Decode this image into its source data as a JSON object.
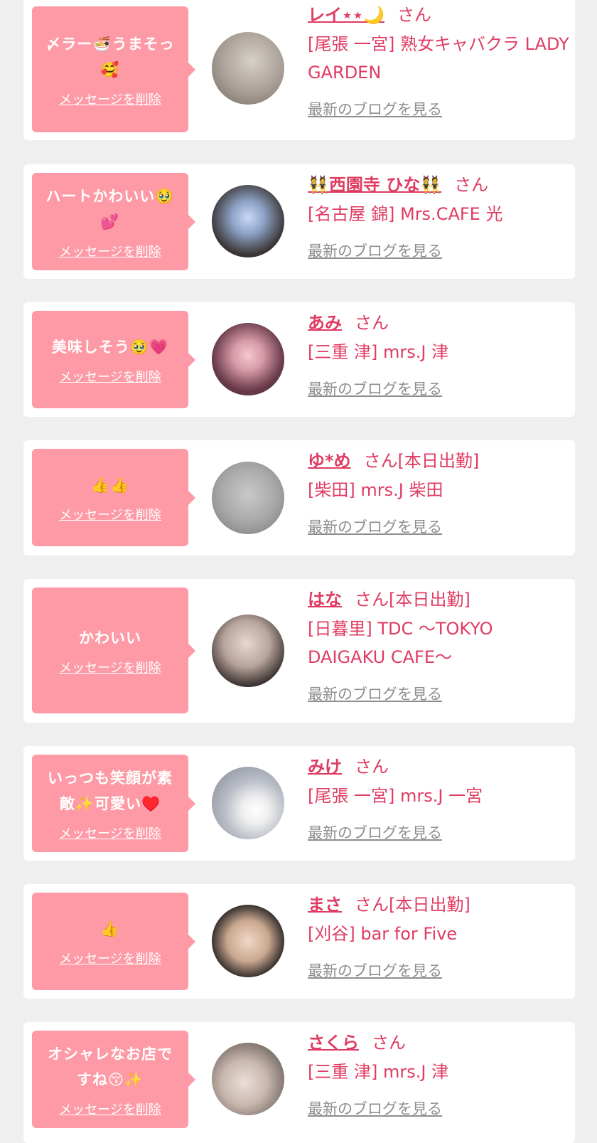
{
  "colors": {
    "page_bg": "#efefef",
    "card_bg": "#ffffff",
    "bubble_bg": "#fe9aa5",
    "accent_pink": "#e03b62",
    "link_gray": "#8e8e8e"
  },
  "delete_label": "メッセージを削除",
  "blog_label": "最新のブログを見る",
  "items": [
    {
      "message": "〆ラー🍜うまそっ🥰",
      "name": "レイ⋆⋆🌙",
      "suffix": "さん",
      "shop": "[尾張 一宮] 熟女キャバクラ LADY GARDEN"
    },
    {
      "message": "ハートかわいい🥹💕",
      "name": "👯西園寺 ひな👯",
      "suffix": "さん",
      "shop": "[名古屋 錦] Mrs.CAFE 光"
    },
    {
      "message": "美味しそう🥹💗",
      "name": "あみ",
      "suffix": "さん",
      "shop": "[三重 津] mrs.J 津"
    },
    {
      "message": "👍👍",
      "name": "ゆ*め",
      "suffix": "さん[本日出勤]",
      "shop": "[柴田] mrs.J 柴田"
    },
    {
      "message": "かわいい",
      "name": "はな",
      "suffix": "さん[本日出勤]",
      "shop": "[日暮里] TDC ～TOKYO DAIGAKU CAFE～"
    },
    {
      "message": "いっつも笑顔が素敵✨可愛い♥️",
      "name": "みけ",
      "suffix": "さん",
      "shop": "[尾張 一宮] mrs.J 一宮"
    },
    {
      "message": "👍",
      "name": "まさ",
      "suffix": "さん[本日出勤]",
      "shop": "[刈谷] bar for Five"
    },
    {
      "message": "オシャレなお店ですね😚✨",
      "name": "さくら",
      "suffix": "さん",
      "shop": "[三重 津] mrs.J 津"
    }
  ]
}
